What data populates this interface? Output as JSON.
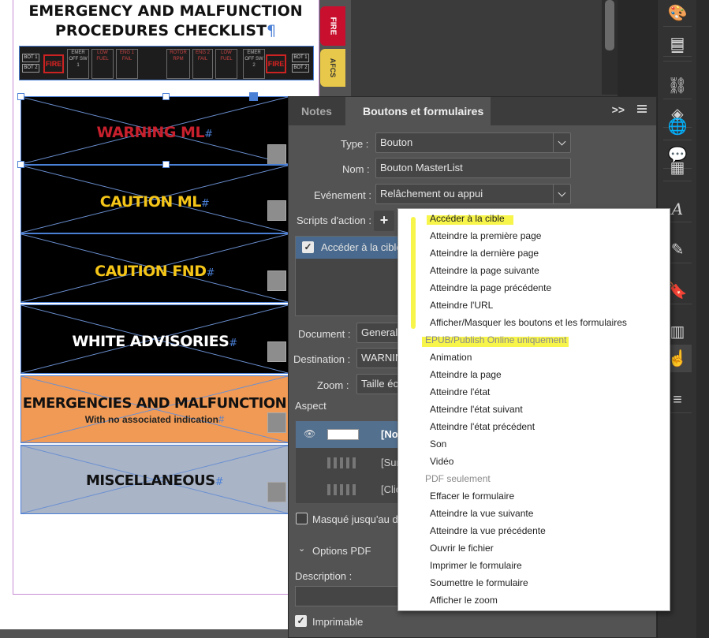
{
  "document": {
    "title_line1": "EMERGENCY AND MALFUNCTION",
    "title_line2": "PROCEDURES CHECKLIST",
    "pilcrow": "¶",
    "side_tabs": {
      "fire": "FIRE",
      "afcs": "AFCS"
    },
    "annunciator": {
      "bot1": "BOT 1",
      "bot2": "BOT 2",
      "fire": "FIRE",
      "emer_sw1": "EMER OFF SW 1",
      "low_fuel": "LOW FUEL",
      "eng1_fail": "ENG 1 FAIL",
      "rotor_rpm": "ROTOR RPM",
      "eng2_fail": "ENG 2 FAIL",
      "low_fuel2": "LOW FUEL",
      "emer_sw2": "EMER OFF SW 2"
    },
    "sections": [
      {
        "label": "WARNING ML",
        "color": "#c8202d",
        "bg": "#000000"
      },
      {
        "label": "CAUTION ML",
        "color": "#f5c518",
        "bg": "#000000"
      },
      {
        "label": "CAUTION FND",
        "color": "#f5c518",
        "bg": "#000000"
      },
      {
        "label": "WHITE ADVISORIES",
        "color": "#ffffff",
        "bg": "#000000"
      },
      {
        "label": "EMERGENCIES AND MALFUNCTION",
        "sub": "With no associated indication",
        "color": "#111111",
        "bg": "#f19a55"
      },
      {
        "label": "MISCELLANEOUS",
        "color": "#111111",
        "bg": "#a9b4c7"
      }
    ],
    "hash": "#"
  },
  "panel": {
    "tabs": [
      "Notes",
      "Boutons et formulaires"
    ],
    "more": ">>",
    "type_label": "Type :",
    "type_value": "Bouton",
    "nom_label": "Nom :",
    "nom_value": "Bouton MasterList",
    "event_label": "Evénement :",
    "event_value": "Relâchement ou appui",
    "scripts_label": "Scripts d'action :",
    "add_icon": "+",
    "action_item": "Accéder à la cible",
    "document_label": "Document :",
    "document_value": "General",
    "destination_label": "Destination :",
    "destination_value": "WARNING",
    "zoom_label": "Zoom :",
    "zoom_value": "Taille éc",
    "aspect_label": "Aspect",
    "states": [
      "[No",
      "[Sur",
      "[Clic"
    ],
    "masque_label": "Masqué jusqu'au dé",
    "options_pdf": "Options PDF",
    "description_label": "Description :",
    "imprimable_label": "Imprimable"
  },
  "menu": {
    "items_a": [
      "Accéder à la cible",
      "Atteindre la première page",
      "Atteindre la dernière page",
      "Atteindre la page suivante",
      "Atteindre la page précédente",
      "Atteindre l'URL",
      "Afficher/Masquer les boutons et les formulaires"
    ],
    "header_epub": "EPUB/Publish Online uniquement",
    "items_b": [
      "Animation",
      "Atteindre la page",
      "Atteindre l'état",
      "Atteindre l'état suivant",
      "Atteindre l'état précédent",
      "Son",
      "Vidéo"
    ],
    "header_pdf": "PDF seulement",
    "items_c": [
      "Effacer le formulaire",
      "Atteindre la vue suivante",
      "Atteindre la vue précédente",
      "Ouvrir le fichier",
      "Imprimer le formulaire",
      "Soumettre le formulaire",
      "Afficher le zoom"
    ]
  },
  "toolbar": {
    "icons": [
      "palette-icon",
      "layers-stack-icon",
      "align-icon",
      "link-icon",
      "layers-icon",
      "hyperlink-icon",
      "comment-icon",
      "swatches-icon",
      "glyph-icon",
      "pdf-sign-icon",
      "bookmark-icon",
      "forms-icon",
      "buttons-forms-icon",
      "sliders-icon"
    ]
  },
  "colors": {
    "highlight": "#f6f32a",
    "selection": "#4a7fd6",
    "panel_bg": "#535353"
  }
}
